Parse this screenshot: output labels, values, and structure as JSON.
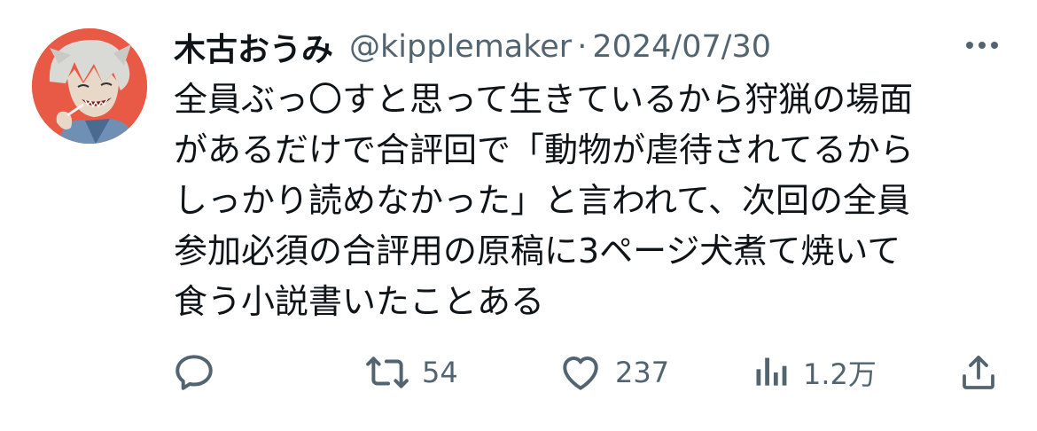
{
  "tweet": {
    "display_name": "木古おうみ",
    "handle": "@kipplemaker",
    "separator": "·",
    "date": "2024/07/30",
    "text": "全員ぶっ〇すと思って生きているから狩猟の場面\nがあるだけで合評回で「動物が虐待されてるから\nしっかり読めなかった」と言われて、次回の全員\n参加必須の合評用の原稿に3ページ犬煮て焼いて\n食う小説書いたことある"
  },
  "actions": {
    "reply": {
      "icon": "reply-icon"
    },
    "retweet": {
      "icon": "retweet-icon",
      "count": "54"
    },
    "like": {
      "icon": "heart-icon",
      "count": "237"
    },
    "views": {
      "icon": "bar-chart-icon",
      "count": "1.2万"
    },
    "share": {
      "icon": "share-icon"
    }
  },
  "colors": {
    "text": "#0f1419",
    "muted": "#536471",
    "avatar_bg": "#e85a45"
  }
}
